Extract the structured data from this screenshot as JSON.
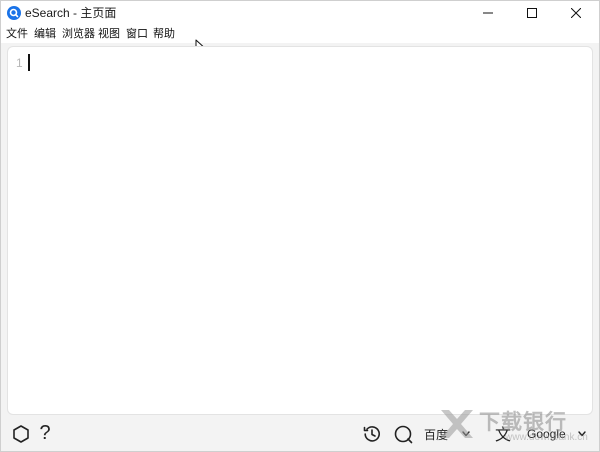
{
  "window": {
    "title": "eSearch - 主页面"
  },
  "menu": {
    "items": [
      "文件",
      "编辑",
      "浏览器",
      "视图",
      "窗口",
      "帮助"
    ]
  },
  "editor": {
    "line_number": "1",
    "content": ""
  },
  "toolbar": {
    "help_label": "?",
    "search_engine": "百度",
    "translate_glyph": "文",
    "translate_engine": "Google"
  },
  "watermark": {
    "text": "下载银行",
    "url": "www.downbank.cn"
  },
  "icons": {
    "app": "esearch-logo-icon",
    "hexagon": "hexagon-icon",
    "history": "history-icon",
    "search": "search-icon",
    "translate": "translate-icon"
  },
  "colors": {
    "app_icon": "#1a73e8",
    "background": "#f3f3f3",
    "editor_bg": "#ffffff"
  }
}
